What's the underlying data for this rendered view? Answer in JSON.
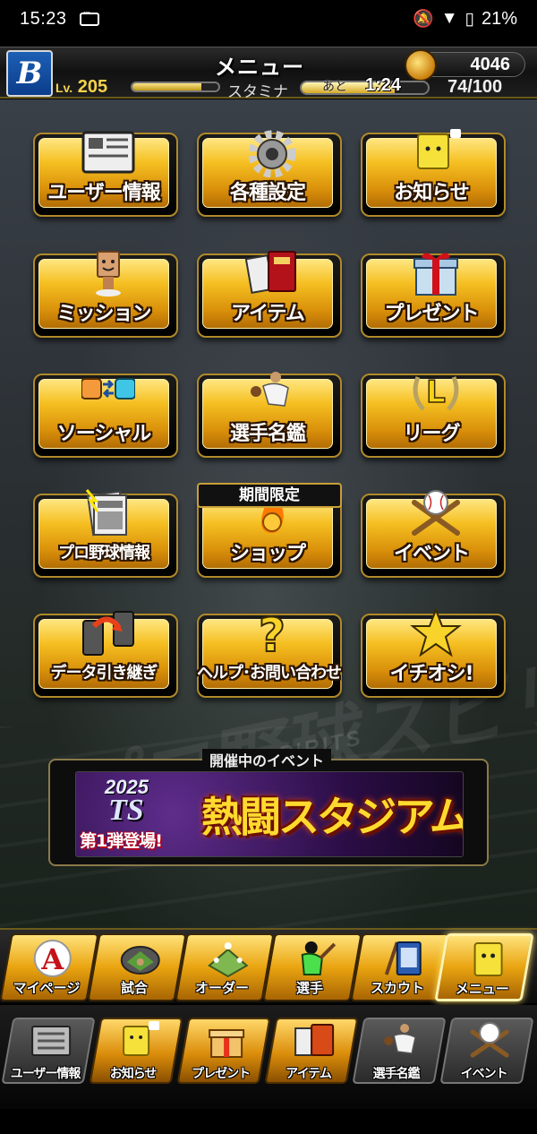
{
  "status_bar": {
    "time": "15:23",
    "battery": "21%"
  },
  "header": {
    "title": "メニュー",
    "coins": "4046",
    "level_prefix": "Lv.",
    "level": "205",
    "exp_fraction": 0.8,
    "stamina_label": "スタミナ",
    "recover_prefix": "あと",
    "recover_time": "1:24",
    "stamina": "74/100",
    "stamina_fraction": 0.74
  },
  "menu": {
    "items": [
      {
        "label": "ユーザー情報",
        "icon": "newspaper-icon"
      },
      {
        "label": "各種設定",
        "icon": "gear-icon"
      },
      {
        "label": "お知らせ",
        "icon": "mascot-notice-icon"
      },
      {
        "label": "ミッション",
        "icon": "mascot-mission-icon"
      },
      {
        "label": "アイテム",
        "icon": "item-book-icon"
      },
      {
        "label": "プレゼント",
        "icon": "gift-box-icon"
      },
      {
        "label": "ソーシャル",
        "icon": "social-faces-icon"
      },
      {
        "label": "選手名鑑",
        "icon": "pitcher-icon"
      },
      {
        "label": "リーグ",
        "icon": "laurel-l-icon"
      },
      {
        "label": "プロ野球情報",
        "icon": "newspaper-stack-icon"
      },
      {
        "label": "ショップ",
        "icon": "fire-coin-icon"
      },
      {
        "label": "イベント",
        "icon": "baseball-bats-icon"
      },
      {
        "label": "データ引き継ぎ",
        "icon": "phone-transfer-icon"
      },
      {
        "label": "ヘルプ･お問い合わせ",
        "icon": "question-icon"
      },
      {
        "label": "イチオシ!",
        "icon": "star-icon"
      }
    ],
    "limited_badge": "期間限定"
  },
  "event": {
    "section_title": "開催中のイベント",
    "banner_year": "2025",
    "banner_ts": "TS",
    "banner_sub": "第1弾登場!",
    "banner_main": "熱闘スタジアム"
  },
  "nav_primary": [
    {
      "label": "マイページ",
      "icon": "a-logo-icon"
    },
    {
      "label": "試合",
      "icon": "stadium-icon"
    },
    {
      "label": "オーダー",
      "icon": "field-order-icon"
    },
    {
      "label": "選手",
      "icon": "batter-icon"
    },
    {
      "label": "スカウト",
      "icon": "scout-card-icon"
    },
    {
      "label": "メニュー",
      "icon": "mascot-menu-icon",
      "active": true
    }
  ],
  "nav_secondary": [
    {
      "label": "ユーザー情報",
      "icon": "newspaper-icon"
    },
    {
      "label": "お知らせ",
      "icon": "mascot-notice-icon"
    },
    {
      "label": "プレゼント",
      "icon": "gift-box-icon"
    },
    {
      "label": "アイテム",
      "icon": "item-book-icon"
    },
    {
      "label": "選手名鑑",
      "icon": "pitcher-icon"
    },
    {
      "label": "イベント",
      "icon": "baseball-bats-icon"
    }
  ],
  "background_text": "プロ野球スピリッツA",
  "background_sub": "PROFESSIONAL SPIRITS"
}
